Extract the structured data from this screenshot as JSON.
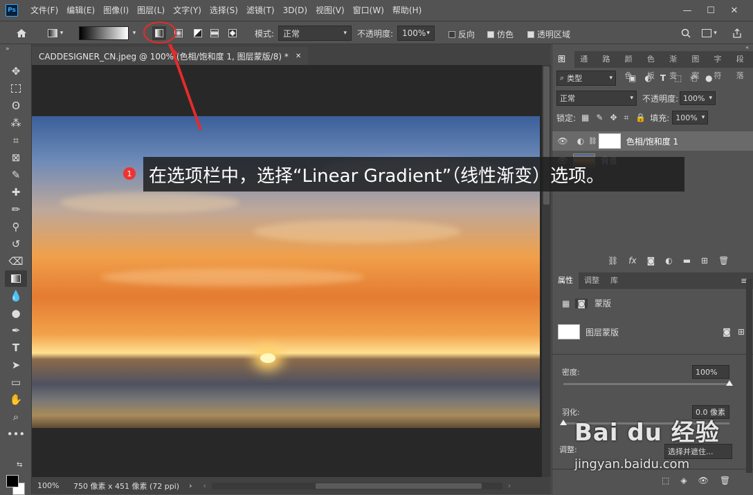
{
  "app": {
    "logo": "Ps"
  },
  "menu": [
    "文件(F)",
    "编辑(E)",
    "图像(I)",
    "图层(L)",
    "文字(Y)",
    "选择(S)",
    "滤镜(T)",
    "3D(D)",
    "视图(V)",
    "窗口(W)",
    "帮助(H)"
  ],
  "window_controls": {
    "minimize": "—",
    "maximize": "☐",
    "close": "✕"
  },
  "options": {
    "mode_label": "模式:",
    "mode_value": "正常",
    "opacity_label": "不透明度:",
    "opacity_value": "100%",
    "reverse_label": "反向",
    "dither_label": "仿色",
    "transparency_label": "透明区域"
  },
  "document": {
    "tab_title": "CADDESIGNER_CN.jpeg @ 100% (色相/饱和度 1, 图层蒙版/8) *",
    "zoom": "100%",
    "dimensions": "750 像素 x 451 像素 (72 ppi)"
  },
  "callout": {
    "number": "1",
    "text": "在选项栏中，选择“Linear Gradient”（线性渐变）选项。"
  },
  "layers_panel": {
    "tabs": [
      "图层",
      "通道",
      "路径",
      "颜色",
      "色板",
      "渐变",
      "图案",
      "字符",
      "段落"
    ],
    "filter": "类型",
    "blend_mode": "正常",
    "opacity_label": "不透明度:",
    "opacity_value": "100%",
    "lock_label": "锁定:",
    "fill_label": "填充:",
    "fill_value": "100%",
    "layers": [
      {
        "name": "色相/饱和度 1"
      },
      {
        "name": "背景"
      }
    ]
  },
  "properties_panel": {
    "tabs": [
      "属性",
      "调整",
      "库"
    ],
    "header": "蒙版",
    "mask_label": "图层蒙版",
    "density_label": "密度:",
    "density_value": "100%",
    "feather_label": "羽化:",
    "feather_value": "0.0 像素",
    "adjust_label": "调整:",
    "select_button": "选择并遮住..."
  },
  "watermark": {
    "brand": "Bai du 经验",
    "url": "jingyan.baidu.com"
  },
  "colors": {
    "accent": "#31a8ff",
    "highlight": "#e52b2b"
  }
}
